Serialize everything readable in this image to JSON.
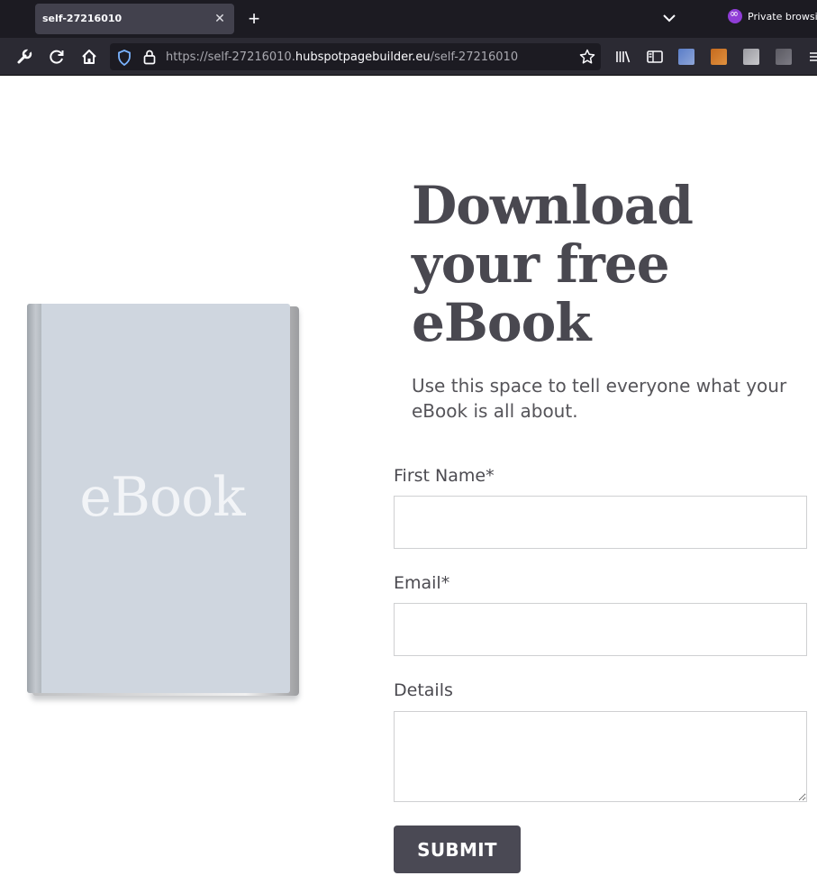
{
  "browser": {
    "tab_title": "self-27216010",
    "private_label": "Private browsi",
    "url_prefix": "https://self-27216010.",
    "url_host": "hubspotpagebuilder.eu",
    "url_path": "/self-27216010"
  },
  "hero": {
    "book_cover_text": "eBook",
    "headline_lines": [
      "Download",
      "your free",
      "eBook"
    ],
    "description": "Use this space to tell everyone what your eBook is all about."
  },
  "form": {
    "first_name_label": "First Name*",
    "first_name_value": "",
    "email_label": "Email*",
    "email_value": "",
    "details_label": "Details",
    "details_value": "",
    "submit_label": "SUBMIT"
  },
  "colors": {
    "accent": "#4a4954",
    "headline": "#494850",
    "book_cover": "#cfd6df"
  },
  "icons": {
    "toolbar": [
      "wrench-icon",
      "reload-icon",
      "home-icon",
      "shield-icon",
      "lock-icon",
      "star-icon",
      "library-icon",
      "sidebar-icon"
    ]
  }
}
